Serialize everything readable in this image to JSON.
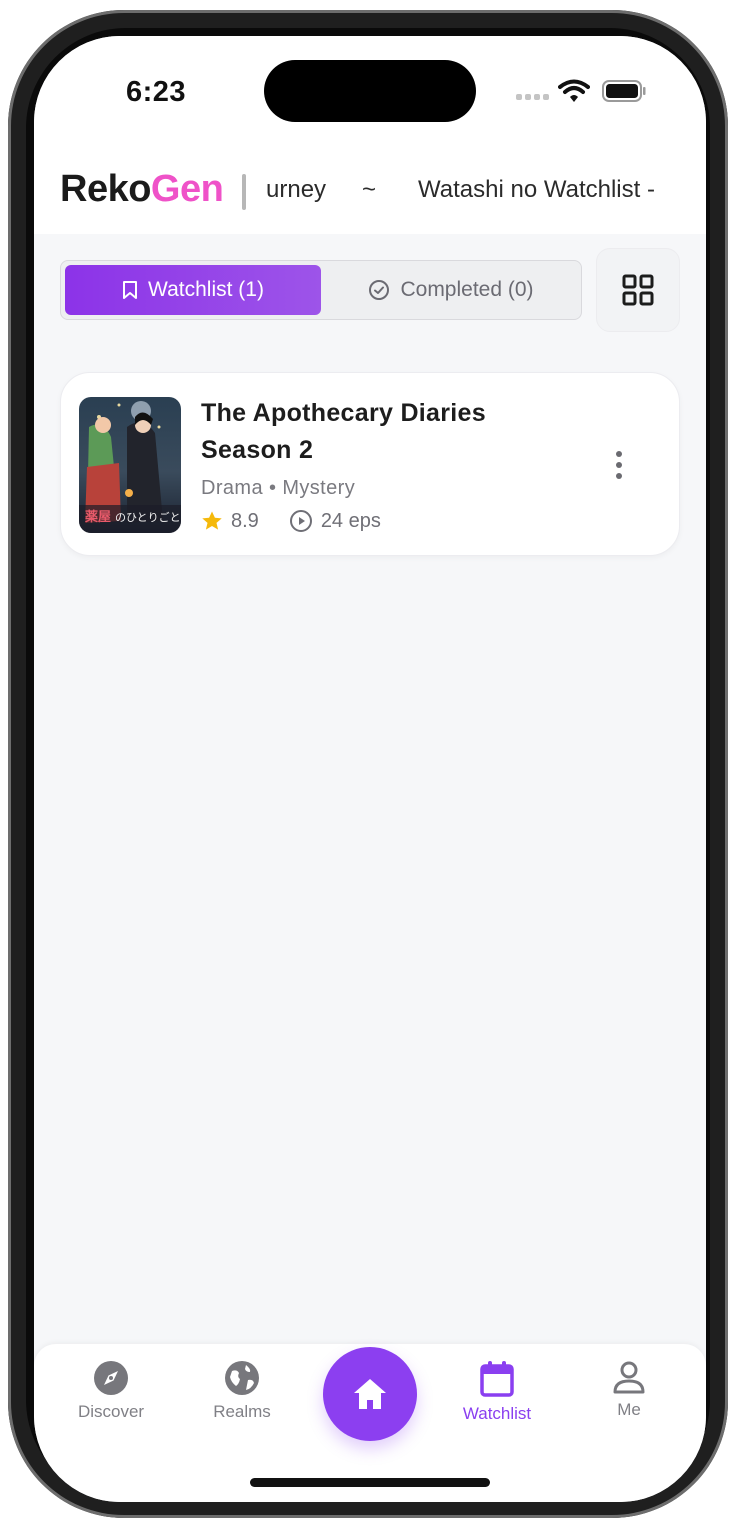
{
  "status_bar": {
    "time": "6:23"
  },
  "header": {
    "logo_part1": "Reko",
    "logo_part2": "Gen",
    "marquee": [
      "urney",
      "~",
      "Watashi no Watchlist -"
    ]
  },
  "tabs": {
    "watchlist_label": "Watchlist (1)",
    "completed_label": "Completed (0)"
  },
  "items": [
    {
      "title_line1": "The Apothecary Diaries",
      "title_line2": "Season 2",
      "genres": "Drama • Mystery",
      "rating": "8.9",
      "episodes": "24 eps"
    }
  ],
  "bottom_nav": {
    "items": [
      {
        "label": "Discover",
        "icon": "compass-icon"
      },
      {
        "label": "Realms",
        "icon": "globe-icon"
      },
      {
        "label": "Home",
        "icon": "home-icon"
      },
      {
        "label": "Watchlist",
        "icon": "calendar-icon"
      },
      {
        "label": "Me",
        "icon": "person-icon"
      }
    ]
  },
  "colors": {
    "accent": "#8c3ff0",
    "logo_accent": "#ef52c8",
    "star": "#f5b90b",
    "background": "#f6f7f9"
  }
}
